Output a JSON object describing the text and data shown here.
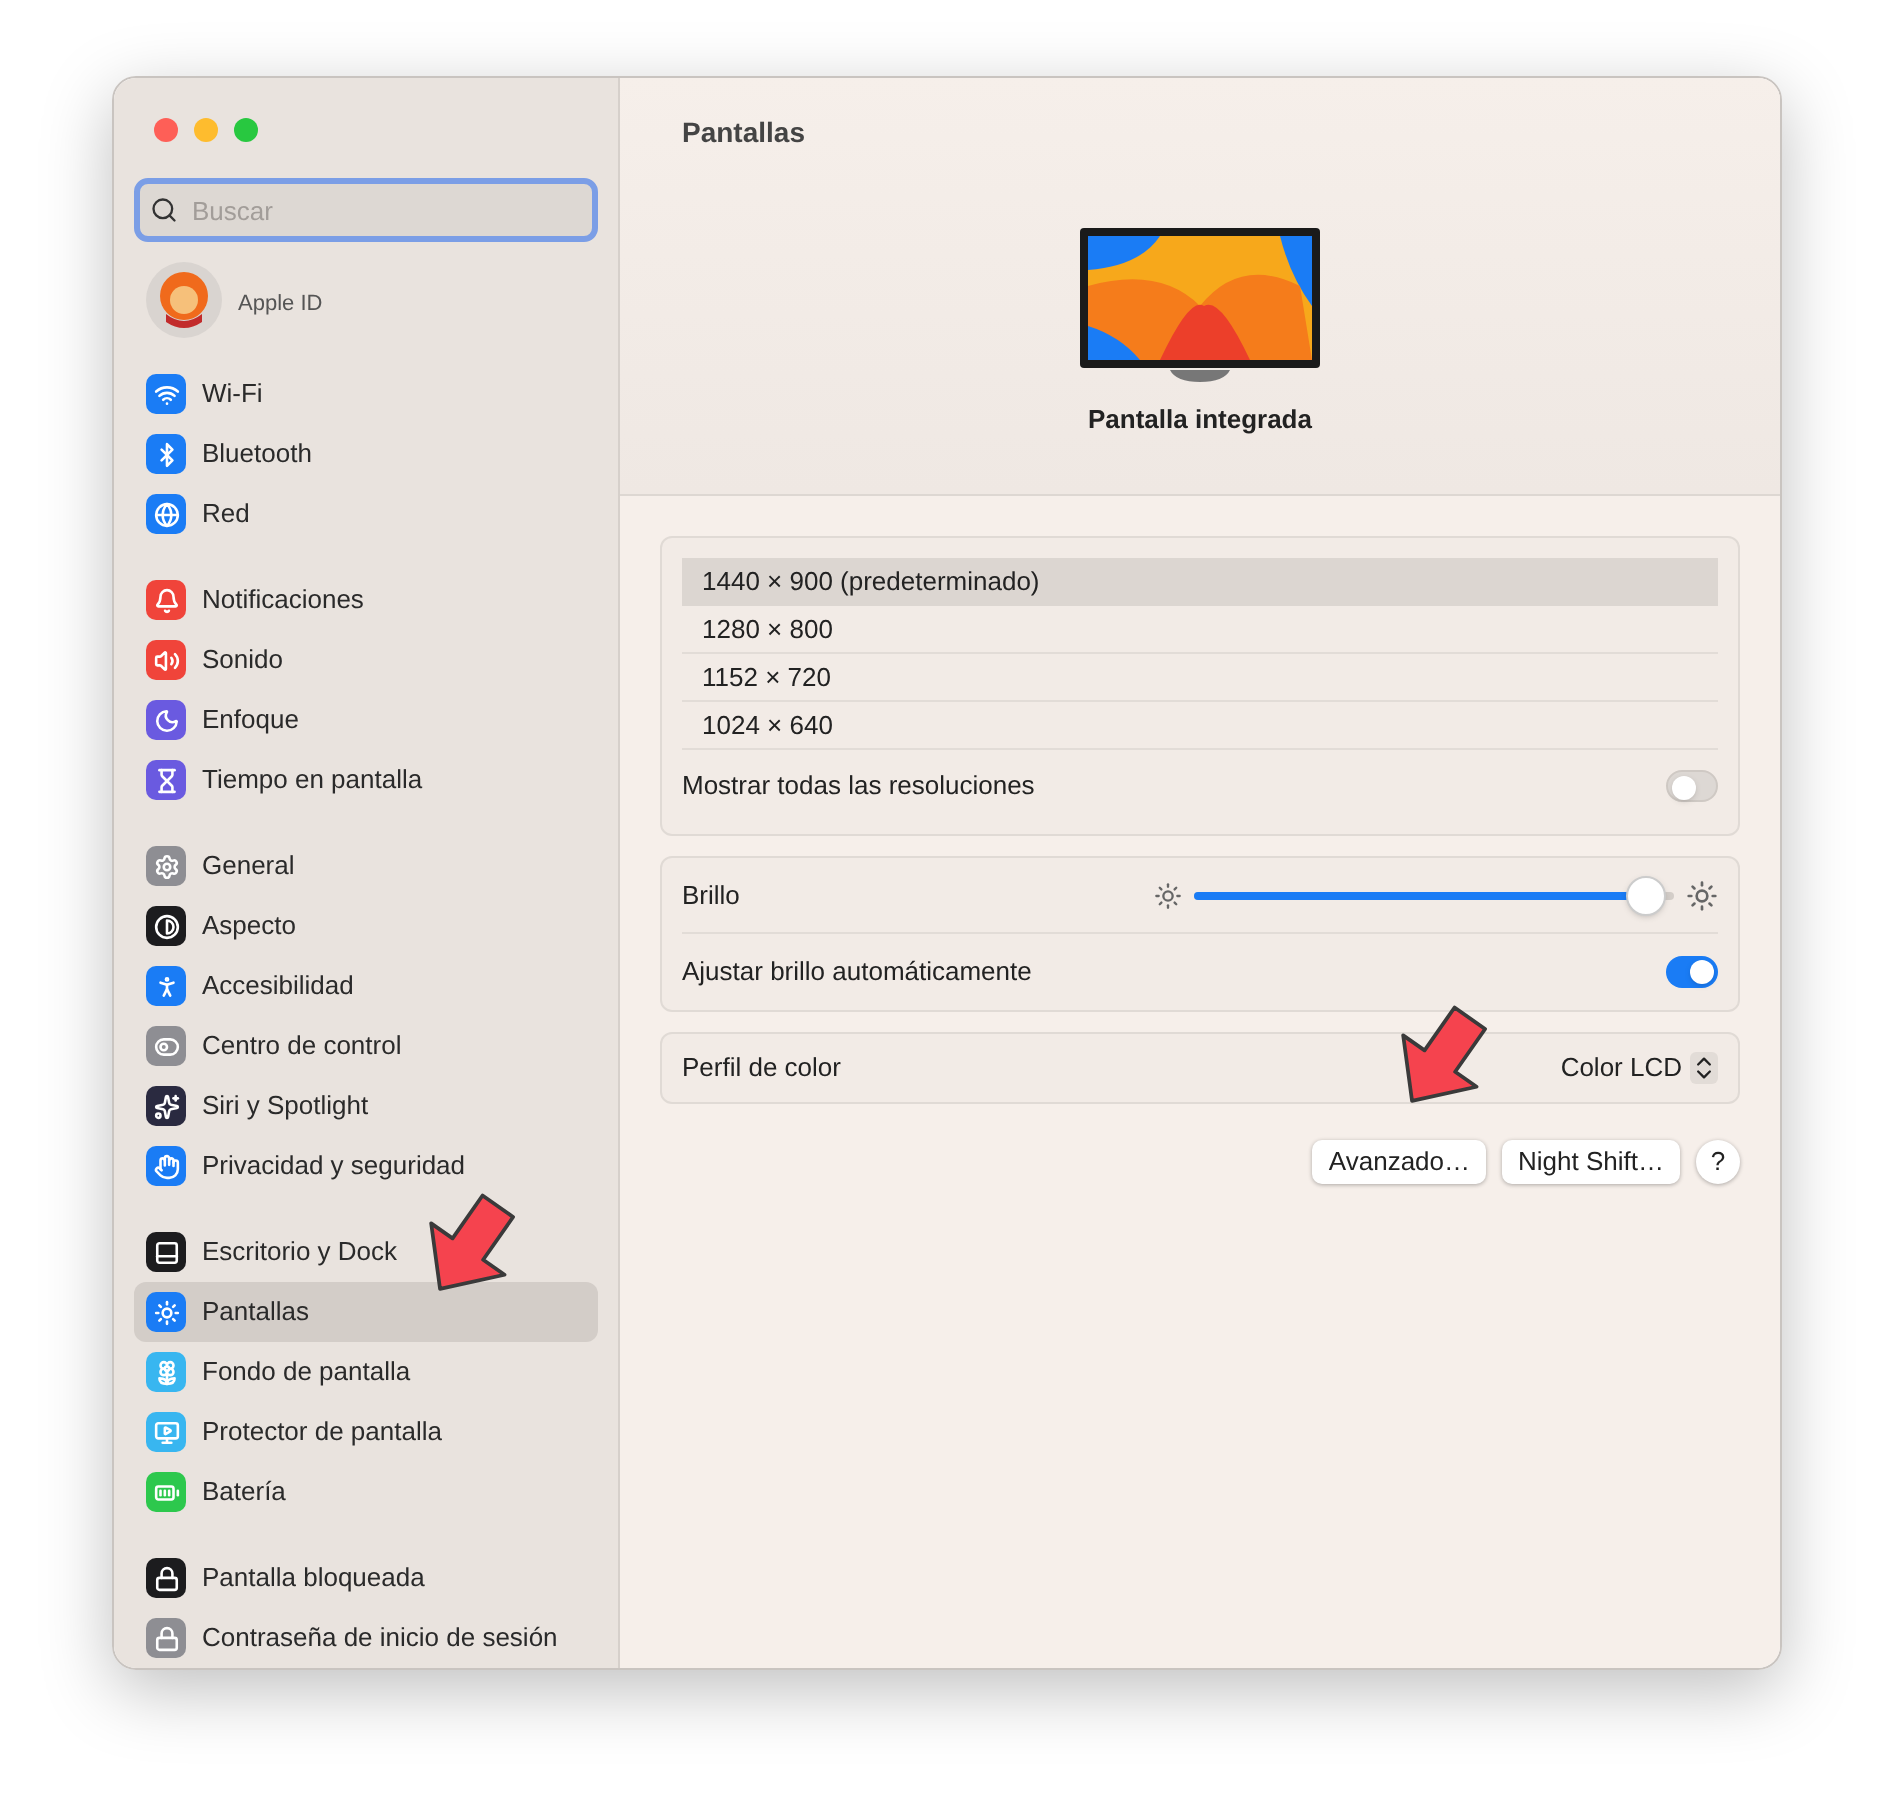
{
  "window": {
    "title": "Pantallas"
  },
  "search": {
    "placeholder": "Buscar"
  },
  "account": {
    "label": "Apple ID"
  },
  "sidebar": {
    "groups": [
      {
        "items": [
          {
            "label": "Wi-Fi",
            "kind": "wifi",
            "color": "#1a7cf5",
            "selected": false
          },
          {
            "label": "Bluetooth",
            "kind": "bluetooth",
            "color": "#1a7cf5",
            "selected": false
          },
          {
            "label": "Red",
            "kind": "network",
            "color": "#1a7cf5",
            "selected": false
          }
        ]
      },
      {
        "items": [
          {
            "label": "Notificaciones",
            "kind": "notifications",
            "color": "#f0443a",
            "selected": false
          },
          {
            "label": "Sonido",
            "kind": "sound",
            "color": "#f0443a",
            "selected": false
          },
          {
            "label": "Enfoque",
            "kind": "focus",
            "color": "#6a5ae0",
            "selected": false
          },
          {
            "label": "Tiempo en pantalla",
            "kind": "screentime",
            "color": "#6a5ae0",
            "selected": false
          }
        ]
      },
      {
        "items": [
          {
            "label": "General",
            "kind": "general",
            "color": "#8e8e93",
            "selected": false
          },
          {
            "label": "Aspecto",
            "kind": "appearance",
            "color": "#1c1c1e",
            "selected": false
          },
          {
            "label": "Accesibilidad",
            "kind": "accessibility",
            "color": "#1a7cf5",
            "selected": false
          },
          {
            "label": "Centro de control",
            "kind": "control",
            "color": "#8e8e93",
            "selected": false
          },
          {
            "label": "Siri y Spotlight",
            "kind": "siri",
            "color": "#2a2a40",
            "selected": false
          },
          {
            "label": "Privacidad y seguridad",
            "kind": "privacy",
            "color": "#1a7cf5",
            "selected": false
          }
        ]
      },
      {
        "items": [
          {
            "label": "Escritorio y Dock",
            "kind": "dock",
            "color": "#1c1c1e",
            "selected": false
          },
          {
            "label": "Pantallas",
            "kind": "displays",
            "color": "#1a7cf5",
            "selected": true
          },
          {
            "label": "Fondo de pantalla",
            "kind": "wallpaper",
            "color": "#38b6f0",
            "selected": false
          },
          {
            "label": "Protector de pantalla",
            "kind": "screensaver",
            "color": "#38b6f0",
            "selected": false
          },
          {
            "label": "Batería",
            "kind": "battery",
            "color": "#2dc84d",
            "selected": false
          }
        ]
      },
      {
        "items": [
          {
            "label": "Pantalla bloqueada",
            "kind": "lock",
            "color": "#1c1c1e",
            "selected": false
          },
          {
            "label": "Contraseña de inicio de sesión",
            "kind": "password",
            "color": "#8e8e93",
            "selected": false
          }
        ]
      }
    ]
  },
  "display": {
    "name": "Pantalla integrada"
  },
  "resolutions": [
    {
      "label": "1440 × 900 (predeterminado)",
      "selected": true
    },
    {
      "label": "1280 × 800",
      "selected": false
    },
    {
      "label": "1152 × 720",
      "selected": false
    },
    {
      "label": "1024 × 640",
      "selected": false
    }
  ],
  "show_all": {
    "label": "Mostrar todas las resoluciones",
    "on": false
  },
  "brightness": {
    "label": "Brillo",
    "level": 0.94
  },
  "auto_brightness": {
    "label": "Ajustar brillo automáticamente",
    "on": true
  },
  "color_profile": {
    "label": "Perfil de color",
    "value": "Color LCD"
  },
  "buttons": [
    "Avanzado…",
    "Night Shift…",
    "?"
  ]
}
